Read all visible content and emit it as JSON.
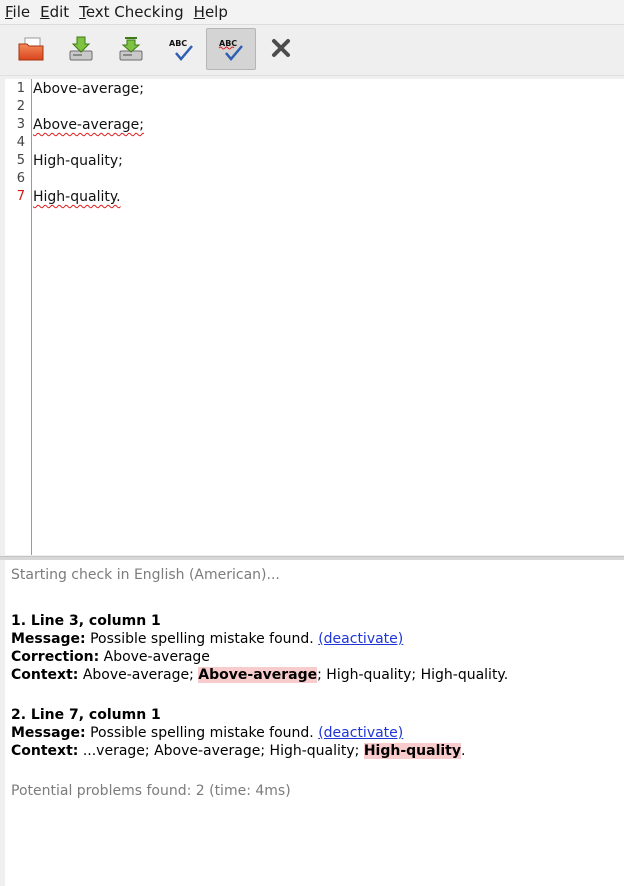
{
  "menu": {
    "file": {
      "mn": "F",
      "rest": "ile"
    },
    "edit": {
      "mn": "E",
      "rest": "dit"
    },
    "text_checking": {
      "mn": "T",
      "rest": "ext Checking"
    },
    "help": {
      "mn": "H",
      "rest": "elp"
    }
  },
  "toolbar": {
    "icons": [
      "open-file-icon",
      "save-icon",
      "save-as-icon",
      "spell-check-icon",
      "spell-check-auto-icon",
      "close-icon"
    ],
    "active_index": 4
  },
  "editor": {
    "line_numbers": [
      "1",
      "2",
      "3",
      "4",
      "5",
      "6",
      "7"
    ],
    "lines": [
      "Above-average;",
      "",
      "Above-average;",
      "",
      "High-quality;",
      "",
      "High-quality."
    ]
  },
  "results": {
    "status": "Starting check in English (American)...",
    "problems": [
      {
        "heading": "1. Line 3, column 1",
        "message_label": "Message:",
        "message": " Possible spelling mistake found. ",
        "deactivate": "(deactivate)",
        "correction_label": "Correction:",
        "correction": " Above-average",
        "context_label": "Context:",
        "context_before": " Above-average; ",
        "context_error": "Above-average",
        "context_after": "; High-quality; High-quality."
      },
      {
        "heading": "2. Line 7, column 1",
        "message_label": "Message:",
        "message": " Possible spelling mistake found. ",
        "deactivate": "(deactivate)",
        "context_label": "Context:",
        "context_before": " ...verage; Above-average; High-quality; ",
        "context_error": "High-quality",
        "context_after": "."
      }
    ],
    "summary": "Potential problems found: 2 (time: 4ms)"
  },
  "colors": {
    "error": "#e01b1b",
    "highlight": "#f8cccc",
    "link": "#1f35d6"
  }
}
